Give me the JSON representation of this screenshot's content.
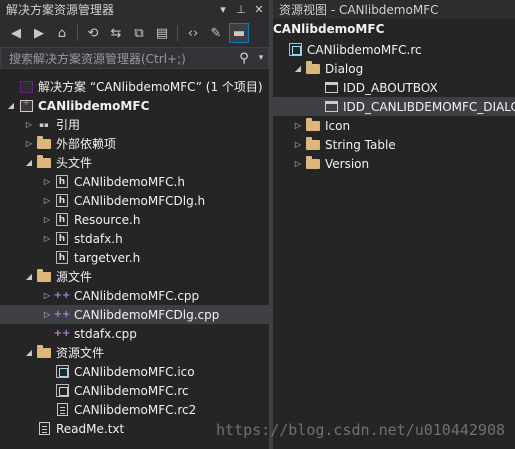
{
  "left": {
    "title": "解决方案资源管理器",
    "search_placeholder": "搜索解决方案资源管理器(Ctrl+;)",
    "toolbar_icons": [
      "back-icon",
      "forward-icon",
      "home-icon",
      "history-icon",
      "sync-icon",
      "collapse-all-icon",
      "show-all-files-icon",
      "code-icon",
      "properties-icon",
      "pending-changes-icon"
    ],
    "tree": [
      {
        "label": "解决方案 “CANlibdemoMFC” (1 个项目)",
        "level": 0,
        "arrow": "",
        "icon": "solution"
      },
      {
        "label": "CANlibdemoMFC",
        "level": 0,
        "arrow": "expanded",
        "icon": "project",
        "bold": true
      },
      {
        "label": "引用",
        "level": 1,
        "arrow": "collapsed",
        "icon": "references"
      },
      {
        "label": "外部依赖项",
        "level": 1,
        "arrow": "collapsed",
        "icon": "external"
      },
      {
        "label": "头文件",
        "level": 1,
        "arrow": "expanded",
        "icon": "folder"
      },
      {
        "label": "CANlibdemoMFC.h",
        "level": 2,
        "arrow": "collapsed",
        "icon": "header"
      },
      {
        "label": "CANlibdemoMFCDlg.h",
        "level": 2,
        "arrow": "collapsed",
        "icon": "header"
      },
      {
        "label": "Resource.h",
        "level": 2,
        "arrow": "collapsed",
        "icon": "header"
      },
      {
        "label": "stdafx.h",
        "level": 2,
        "arrow": "collapsed",
        "icon": "header"
      },
      {
        "label": "targetver.h",
        "level": 2,
        "arrow": "",
        "icon": "header"
      },
      {
        "label": "源文件",
        "level": 1,
        "arrow": "expanded",
        "icon": "folder"
      },
      {
        "label": "CANlibdemoMFC.cpp",
        "level": 2,
        "arrow": "collapsed",
        "icon": "cpp"
      },
      {
        "label": "CANlibdemoMFCDlg.cpp",
        "level": 2,
        "arrow": "collapsed",
        "icon": "cpp",
        "selected": true
      },
      {
        "label": "stdafx.cpp",
        "level": 2,
        "arrow": "",
        "icon": "cpp"
      },
      {
        "label": "资源文件",
        "level": 1,
        "arrow": "expanded",
        "icon": "folder"
      },
      {
        "label": "CANlibdemoMFC.ico",
        "level": 2,
        "arrow": "",
        "icon": "image"
      },
      {
        "label": "CANlibdemoMFC.rc",
        "level": 2,
        "arrow": "",
        "icon": "rc"
      },
      {
        "label": "CANlibdemoMFC.rc2",
        "level": 2,
        "arrow": "",
        "icon": "file"
      },
      {
        "label": "ReadMe.txt",
        "level": 1,
        "arrow": "",
        "icon": "file"
      }
    ]
  },
  "right": {
    "title": "资源视图 - CANlibdemoMFC",
    "project": "CANlibdemoMFC",
    "tree": [
      {
        "label": "CANlibdemoMFC.rc",
        "level": 0,
        "arrow": "",
        "icon": "rc"
      },
      {
        "label": "Dialog",
        "level": 1,
        "arrow": "expanded",
        "icon": "folder"
      },
      {
        "label": "IDD_ABOUTBOX",
        "level": 2,
        "arrow": "",
        "icon": "dialog"
      },
      {
        "label": "IDD_CANLIBDEMOMFC_DIALOG",
        "level": 2,
        "arrow": "",
        "icon": "dialog",
        "selected": true
      },
      {
        "label": "Icon",
        "level": 1,
        "arrow": "collapsed",
        "icon": "folder"
      },
      {
        "label": "String Table",
        "level": 1,
        "arrow": "collapsed",
        "icon": "folder"
      },
      {
        "label": "Version",
        "level": 1,
        "arrow": "collapsed",
        "icon": "folder"
      }
    ]
  },
  "watermark": "https://blog.csdn.net/u010442908",
  "colors": {
    "background": "#252526",
    "titlebar": "#2d2d30",
    "selection": "#3f3f46",
    "accent": "#007acc",
    "folder": "#dcb67a"
  }
}
